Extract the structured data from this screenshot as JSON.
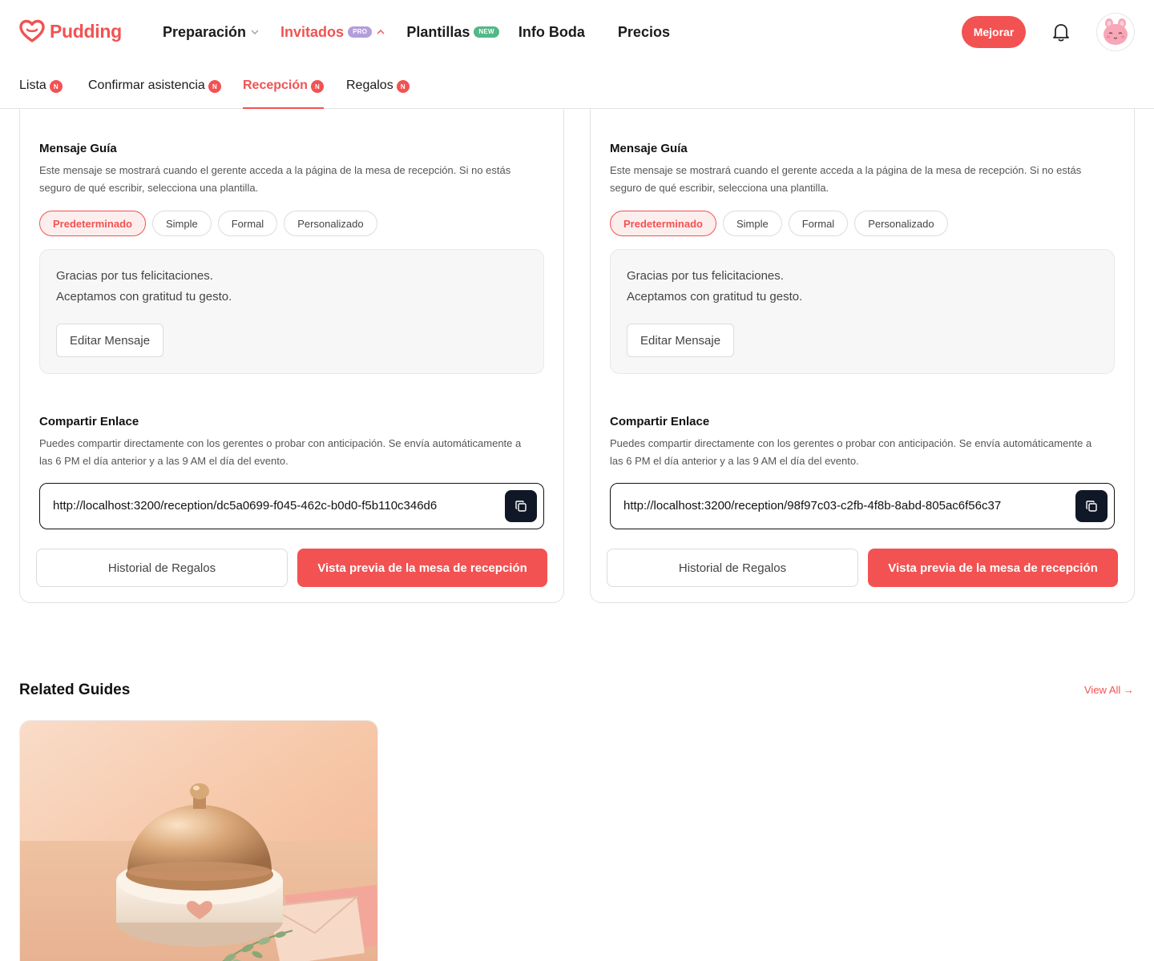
{
  "brand": {
    "name": "Pudding",
    "color": "#f25252"
  },
  "nav": {
    "items": [
      {
        "label": "Preparación",
        "icon": "chevron-down-icon"
      },
      {
        "label": "Invitados",
        "badge": "PRO",
        "icon": "chevron-up-icon",
        "active": true
      },
      {
        "label": "Plantillas",
        "badge": "NEW"
      },
      {
        "label": "Info Boda"
      },
      {
        "label": "Precios"
      }
    ],
    "upgrade_label": "Mejorar",
    "notification_icon": "bell-icon",
    "avatar_icon": "bunny-avatar-icon"
  },
  "subtabs": [
    {
      "label": "Lista",
      "badge": "N"
    },
    {
      "label": "Confirmar asistencia",
      "badge": "N"
    },
    {
      "label": "Recepción",
      "badge": "N",
      "active": true
    },
    {
      "label": "Regalos",
      "badge": "N"
    }
  ],
  "cards": [
    {
      "guide_title": "Mensaje Guía",
      "guide_desc_1": "Este mensaje se mostrará cuando el gerente acceda a la página de la mesa de recepción. Si no estás",
      "guide_desc_2": "seguro de qué escribir, selecciona una plantilla.",
      "templates": [
        "Predeterminado",
        "Simple",
        "Formal",
        "Personalizado"
      ],
      "selected_template": "Predeterminado",
      "message_line_1": "Gracias por tus felicitaciones.",
      "message_line_2": "Aceptamos con gratitud tu gesto.",
      "edit_label": "Editar Mensaje",
      "share_title": "Compartir Enlace",
      "share_desc_1": "Puedes compartir directamente con los gerentes o probar con anticipación. Se envía automáticamente a",
      "share_desc_2": "las 6 PM el día anterior y a las 9 AM el día del evento.",
      "link": "http://localhost:3200/reception/dc5a0699-f045-462c-b0d0-f5b110c346d6",
      "history_label": "Historial de Regalos",
      "preview_label": "Vista previa de la mesa de recepción"
    },
    {
      "guide_title": "Mensaje Guía",
      "guide_desc_1": "Este mensaje se mostrará cuando el gerente acceda a la página de la mesa de recepción. Si no estás",
      "guide_desc_2": "seguro de qué escribir, selecciona una plantilla.",
      "templates": [
        "Predeterminado",
        "Simple",
        "Formal",
        "Personalizado"
      ],
      "selected_template": "Predeterminado",
      "message_line_1": "Gracias por tus felicitaciones.",
      "message_line_2": "Aceptamos con gratitud tu gesto.",
      "edit_label": "Editar Mensaje",
      "share_title": "Compartir Enlace",
      "share_desc_1": "Puedes compartir directamente con los gerentes o probar con anticipación. Se envía automáticamente a",
      "share_desc_2": "las 6 PM el día anterior y a las 9 AM el día del evento.",
      "link": "http://localhost:3200/reception/98f97c03-c2fb-4f8b-8abd-805ac6f56c37",
      "history_label": "Historial de Regalos",
      "preview_label": "Vista previa de la mesa de recepción"
    }
  ],
  "related": {
    "title": "Related Guides",
    "view_all": "View All →",
    "guides": [
      {
        "image_icon": "reception-bell-illustration"
      }
    ]
  }
}
